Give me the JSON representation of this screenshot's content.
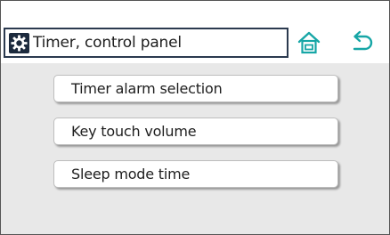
{
  "header": {
    "icon": "settings-gear-icon",
    "title": "Timer, control panel"
  },
  "nav": {
    "home_icon": "home-icon",
    "back_icon": "back-arrow-icon",
    "accent_color": "#16a6a6"
  },
  "menu": {
    "items": [
      {
        "label": "Timer alarm selection"
      },
      {
        "label": "Key touch volume"
      },
      {
        "label": "Sleep mode time"
      }
    ]
  }
}
